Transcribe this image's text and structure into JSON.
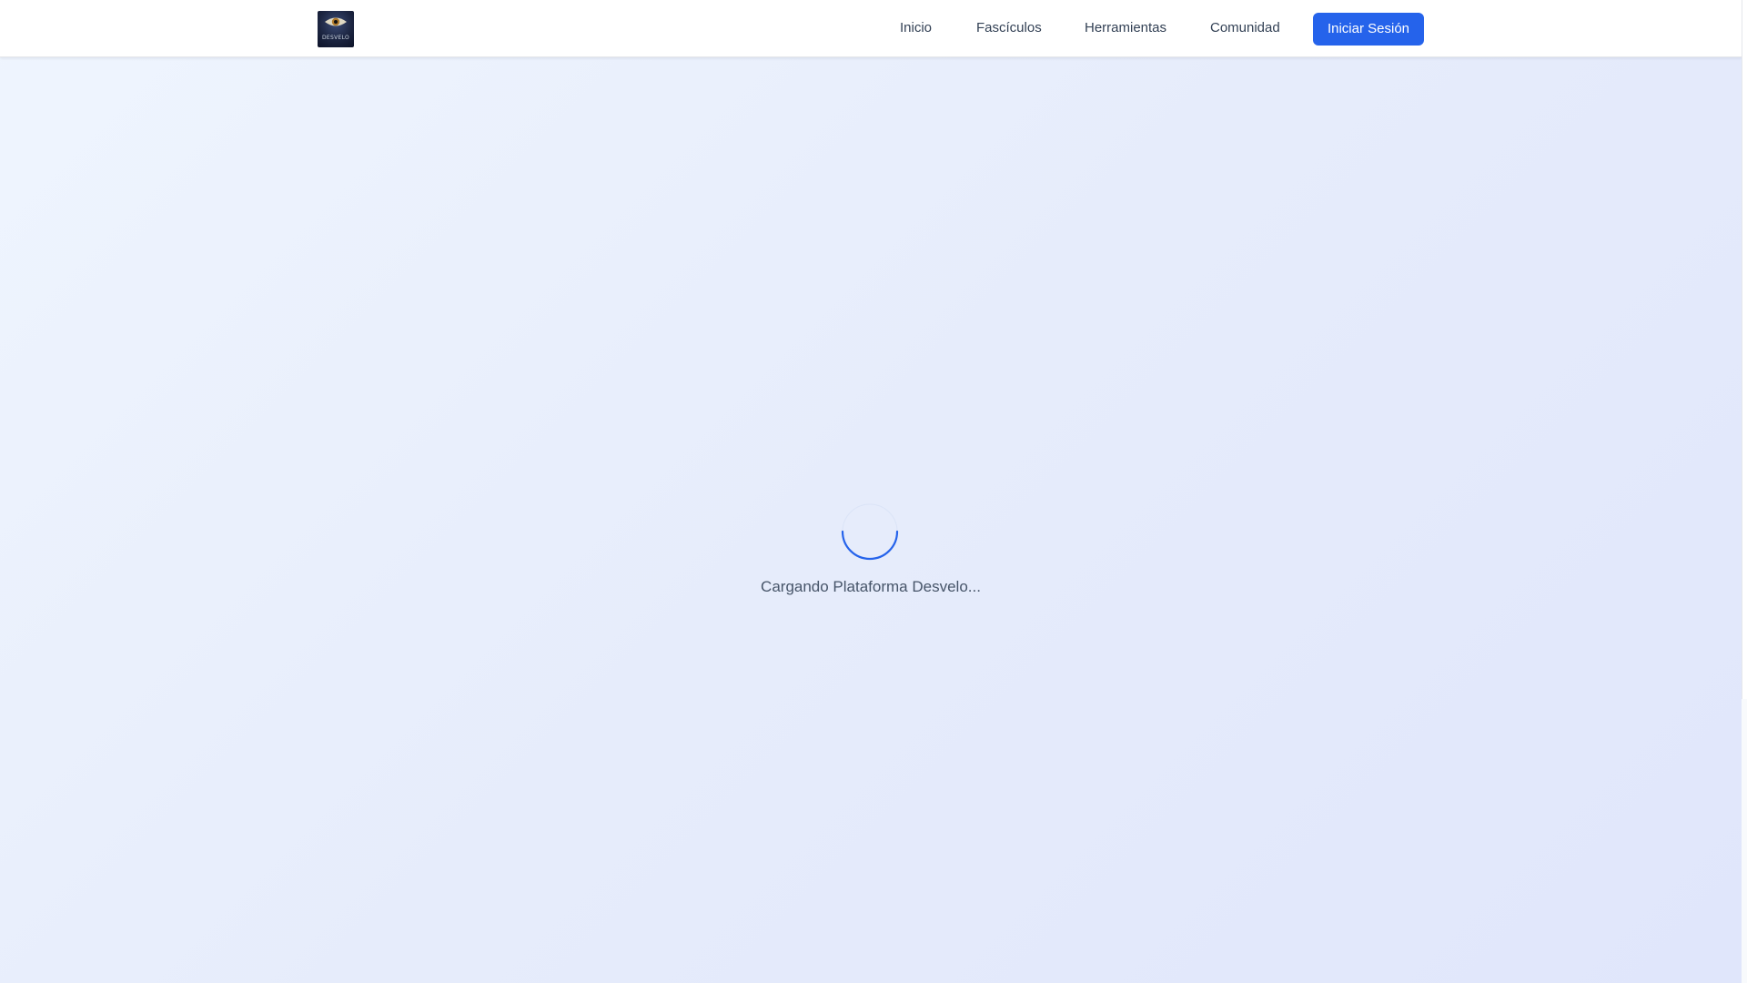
{
  "header": {
    "logo_label": "DESVELO",
    "nav": [
      {
        "label": "Inicio"
      },
      {
        "label": "Fascículos"
      },
      {
        "label": "Herramientas"
      },
      {
        "label": "Comunidad"
      }
    ],
    "login_label": "Iniciar Sesión"
  },
  "main": {
    "loading_text": "Cargando Plataforma Desvelo..."
  },
  "colors": {
    "accent": "#2563eb",
    "background_from": "#eff5fe",
    "background_to": "#e0e6fb",
    "spinner": "#2563eb"
  },
  "icons": {
    "logo": "eye-icon",
    "loader": "spinner-icon"
  }
}
